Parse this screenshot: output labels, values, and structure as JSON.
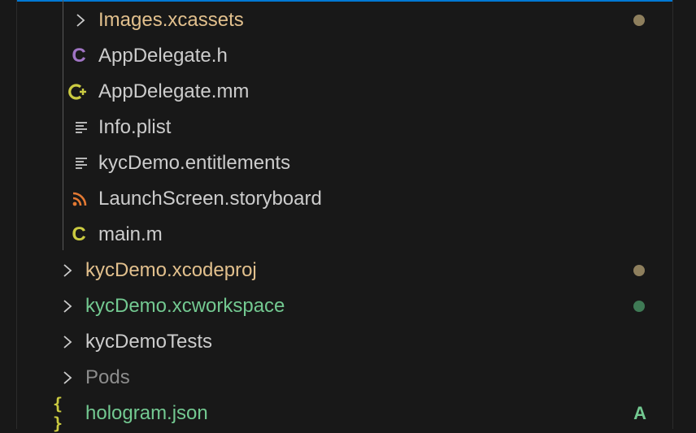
{
  "explorer": {
    "colors": {
      "background": "#181818",
      "focus_border": "#0078d4",
      "text_default": "#cccccc",
      "text_modified": "#e2c08d",
      "text_untracked": "#73c991",
      "text_ignored": "#8c8c8c",
      "c_icon": "#a074c4",
      "c_main_icon": "#cbcb41",
      "cpp_icon": "#cbcb41",
      "xml_icon": "#e37933",
      "json_icon": "#cbcb41",
      "dot_modified": "#8e7f5d",
      "dot_untracked": "#3f7a55"
    },
    "items": [
      {
        "label": "Images.xcassets",
        "kind": "folder",
        "expanded": false,
        "status": "modified",
        "icon": "chevron-right-icon"
      },
      {
        "label": "AppDelegate.h",
        "kind": "file",
        "icon": "c-header-icon",
        "icon_text": "C"
      },
      {
        "label": "AppDelegate.mm",
        "kind": "file",
        "icon": "cpp-file-icon"
      },
      {
        "label": "Info.plist",
        "kind": "file",
        "icon": "text-file-icon"
      },
      {
        "label": "kycDemo.entitlements",
        "kind": "file",
        "icon": "text-file-icon"
      },
      {
        "label": "LaunchScreen.storyboard",
        "kind": "file",
        "icon": "rss-xml-icon"
      },
      {
        "label": "main.m",
        "kind": "file",
        "icon": "c-file-icon",
        "icon_text": "C"
      },
      {
        "label": "kycDemo.xcodeproj",
        "kind": "folder",
        "expanded": false,
        "status": "modified",
        "icon": "chevron-right-icon"
      },
      {
        "label": "kycDemo.xcworkspace",
        "kind": "folder",
        "expanded": false,
        "status": "untracked",
        "icon": "chevron-right-icon"
      },
      {
        "label": "kycDemoTests",
        "kind": "folder",
        "expanded": false,
        "icon": "chevron-right-icon"
      },
      {
        "label": "Pods",
        "kind": "folder",
        "expanded": false,
        "status": "ignored",
        "icon": "chevron-right-icon"
      },
      {
        "label": "hologram.json",
        "kind": "file",
        "status": "added",
        "badge": "A",
        "icon": "json-braces-icon",
        "icon_text": "{ }"
      }
    ]
  }
}
